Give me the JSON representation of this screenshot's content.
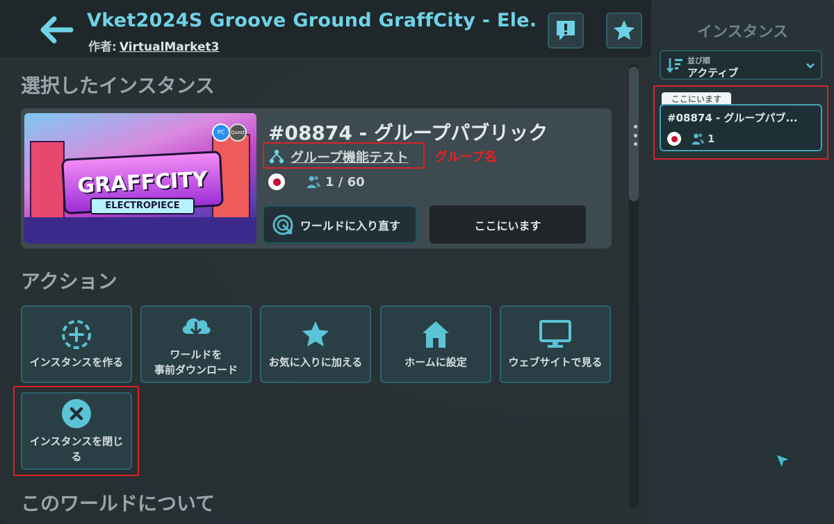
{
  "header": {
    "title": "Vket2024S Groove Ground GraffCity - Ele...",
    "author_label": "作者:",
    "author_name": "VirtualMarket3"
  },
  "sections": {
    "selected_instance": "選択したインスタンス",
    "actions": "アクション",
    "about_world": "このワールドについて"
  },
  "instance": {
    "name": "#08874 - グループパブリック",
    "group_name": "グループ機能テスト",
    "region": "JP",
    "user_count": "1 / 60",
    "rejoin_label": "ワールドに入り直す",
    "here_label": "ここにいます",
    "thumbnail": {
      "logo_text": "GRAFFCITY",
      "sub_text": "ELECTROPIECE",
      "badge_pc": "PC",
      "badge_quest": "Quest"
    }
  },
  "annotations": {
    "group_name_note": "グループ名"
  },
  "actions": [
    {
      "label": "インスタンスを作る",
      "icon": "plus-circle-dashed-icon"
    },
    {
      "label": "ワールドを\n事前ダウンロード",
      "icon": "cloud-download-icon"
    },
    {
      "label": "お気に入りに加える",
      "icon": "star-icon"
    },
    {
      "label": "ホームに設定",
      "icon": "home-icon"
    },
    {
      "label": "ウェブサイトで見る",
      "icon": "monitor-icon"
    },
    {
      "label": "インスタンスを閉じる",
      "icon": "close-circle-icon"
    }
  ],
  "side_panel": {
    "title": "インスタンス",
    "sort_label": "並び順",
    "sort_value": "アクティブ",
    "here_tag": "ここにいます",
    "card": {
      "name": "#08874 - グループパブ...",
      "region": "JP",
      "user_count": "1"
    }
  },
  "colors": {
    "accent": "#6fd3e6",
    "annotation_red": "#d9232a",
    "button_border": "#2c6470"
  }
}
